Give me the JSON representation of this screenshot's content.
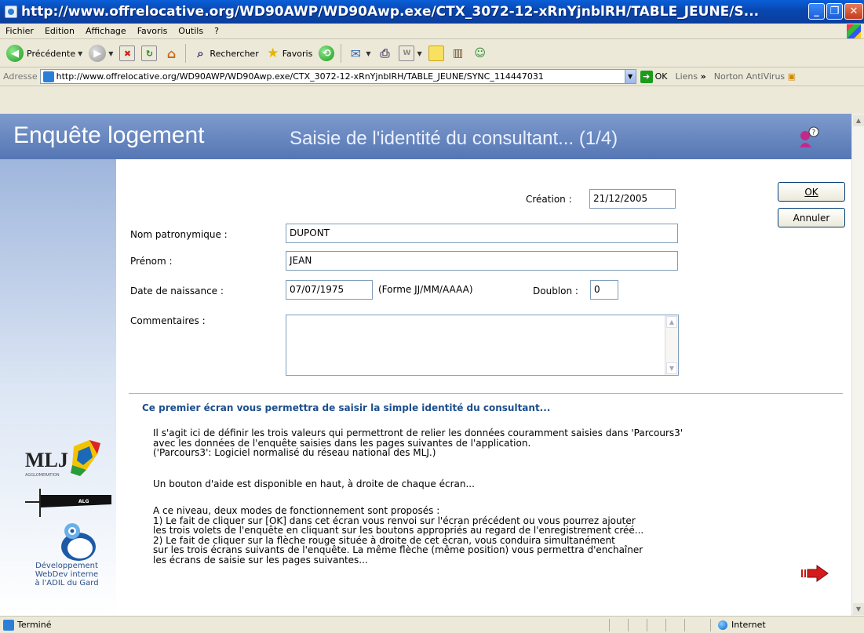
{
  "window": {
    "title": "http://www.offrelocative.org/WD90AWP/WD90Awp.exe/CTX_3072-12-xRnYjnblRH/TABLE_JEUNE/S..."
  },
  "menu": [
    "Fichier",
    "Edition",
    "Affichage",
    "Favoris",
    "Outils",
    "?"
  ],
  "toolbar": {
    "back_label": "Précédente",
    "search_label": "Rechercher",
    "favorites_label": "Favoris"
  },
  "address": {
    "label": "Adresse",
    "url": "http://www.offrelocative.org/WD90AWP/WD90Awp.exe/CTX_3072-12-xRnYjnblRH/TABLE_JEUNE/SYNC_114447031",
    "go_label": "OK",
    "links_label": "Liens",
    "norton_label": "Norton AntiVirus"
  },
  "page": {
    "app_title": "Enquête logement",
    "subtitle": "Saisie de l'identité du consultant... (1/4)"
  },
  "form": {
    "creation_label": "Création :",
    "creation_value": "21/12/2005",
    "nom_label": "Nom patronymique :",
    "nom_value": "DUPONT",
    "prenom_label": "Prénom :",
    "prenom_value": "JEAN",
    "naissance_label": "Date de naissance :",
    "naissance_value": "07/07/1975",
    "naissance_hint": "(Forme JJ/MM/AAAA)",
    "doublon_label": "Doublon :",
    "doublon_value": "0",
    "commentaires_label": "Commentaires :",
    "ok_label": "OK",
    "annuler_label": "Annuler"
  },
  "info": {
    "heading": "Ce premier écran vous permettra de saisir la simple identité du consultant...",
    "p1": [
      "Il s'agit ici de définir les trois valeurs qui permettront de relier les données couramment saisies dans 'Parcours3'",
      "avec les données de l'enquête saisies dans les pages suivantes de l'application.",
      "('Parcours3': Logiciel normalisé du réseau national des MLJ.)"
    ],
    "p2": "Un bouton d'aide est disponible en haut, à droite de chaque écran...",
    "p3": [
      "A ce niveau, deux modes de fonctionnement sont proposés :",
      "1) Le fait de cliquer sur [OK] dans cet écran vous renvoi sur l'écran précédent ou vous pourrez ajouter",
      "les trois volets de l'enquête en cliquant sur les boutons appropriés au regard de l'enregistrement créé...",
      "2) Le fait de cliquer sur la flèche rouge située à droite de cet écran, vous conduira simultanément",
      "sur les trois écrans suivants de l'enquête. La même flèche (même position) vous permettra d'enchaîner",
      "les écrans de saisie sur les pages suivantes..."
    ]
  },
  "sidebar": {
    "logo_mlj_text": "MLJ",
    "logo_mlj_sub": "AGGLOMERATION",
    "logo_alg_text": "ALG",
    "dev_text": [
      "Développement",
      "WebDev interne",
      "à l'ADIL du Gard"
    ]
  },
  "status": {
    "text": "Terminé",
    "zone": "Internet"
  }
}
